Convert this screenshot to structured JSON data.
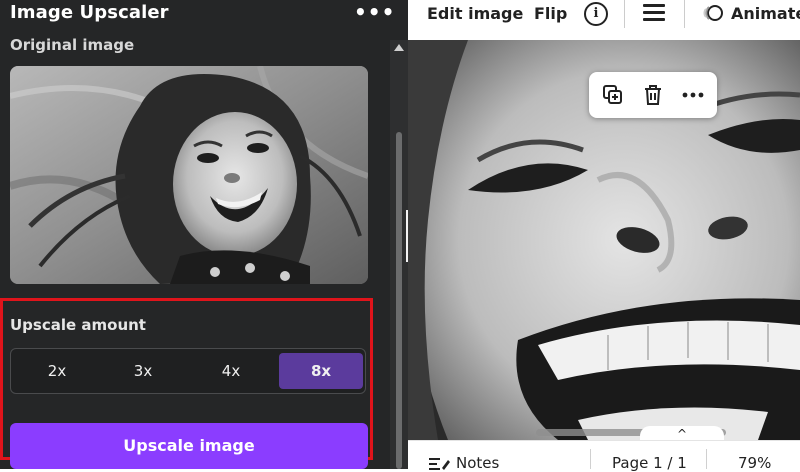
{
  "panel": {
    "title": "Image Upscaler",
    "more_label": "•••",
    "original_image_label": "Original image"
  },
  "upscale": {
    "label": "Upscale amount",
    "options": [
      "2x",
      "3x",
      "4x",
      "8x"
    ],
    "selected": "8x",
    "button_label": "Upscale image"
  },
  "toolbar": {
    "edit_image": "Edit image",
    "flip": "Flip",
    "info": "i",
    "animate": "Animate"
  },
  "footer": {
    "notes": "Notes",
    "page": "Page 1 / 1",
    "zoom": "79%",
    "page_toggle": "^"
  },
  "colors": {
    "panel_bg": "#252627",
    "accent_purple": "#8b3dff",
    "selected_option": "#5b3b9d",
    "highlight_red": "#e0141b"
  },
  "icons": {
    "duplicate": "duplicate-icon",
    "delete": "trash-icon",
    "more": "more-dots-icon",
    "menu": "menu-lines-icon",
    "animate": "animate-icon",
    "notes": "notes-icon",
    "collapse": "chevron-left-icon"
  }
}
